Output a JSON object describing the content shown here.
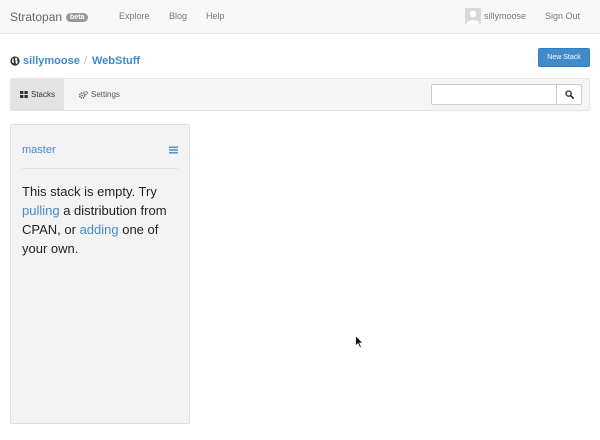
{
  "navbar": {
    "brand": "Stratopan",
    "badge": "beta",
    "links": [
      "Explore",
      "Blog",
      "Help"
    ],
    "username": "sillymoose",
    "signout": "Sign Out"
  },
  "header": {
    "owner": "sillymoose",
    "separator": "/",
    "repo": "WebStuff",
    "new_stack_label": "New Stack"
  },
  "toolbar": {
    "tabs": [
      {
        "label": "Stacks",
        "active": true
      },
      {
        "label": "Settings",
        "active": false
      }
    ],
    "search": {
      "value": "",
      "placeholder": ""
    }
  },
  "stack": {
    "branch": "master",
    "empty_parts": [
      "This stack is empty. Try ",
      "pulling",
      " a distribution from CPAN, or ",
      "adding",
      " one of your own."
    ]
  },
  "colors": {
    "accent": "#428bca",
    "navbar_bg": "#f8f8f8",
    "panel_bg": "#f3f3f3"
  },
  "icons": [
    "globe-icon",
    "grid-icon",
    "gears-icon",
    "search-icon",
    "menu-icon",
    "user-avatar-icon",
    "cursor-icon"
  ]
}
